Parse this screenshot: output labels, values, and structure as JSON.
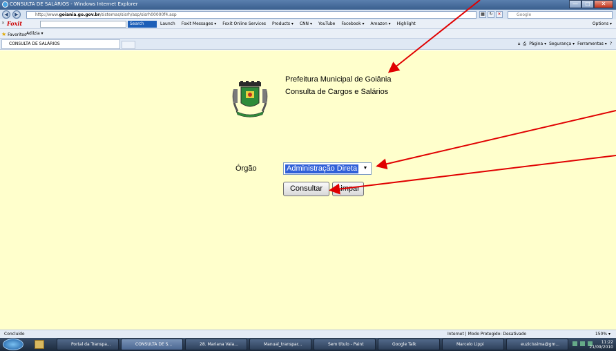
{
  "window": {
    "title": "CONSULTA DE SALÁRIOS - Windows Internet Explorer",
    "controls": [
      "—",
      "▢",
      "✕"
    ]
  },
  "address": {
    "url_prefix": "http://www.",
    "url_domain": "goiania.go.gov.br",
    "url_path": "/sistemas/sisrh/asp/sisrh00000f4.asp",
    "search_placeholder": "Google"
  },
  "foxit_toolbar": {
    "logo": "Foxit",
    "search_button": "Search",
    "links": [
      "Launch",
      "Foxit Messages ▾",
      "Foxit Online Services",
      "Products ▾",
      "CNN ▾",
      "YouTube",
      "Facebook ▾",
      "Amazon ▾",
      "Highlight"
    ],
    "options": "Options ▾"
  },
  "favorites_bar": {
    "favorites": "Favoritos",
    "adilzia": "Adilzia ▾"
  },
  "tab": {
    "label": "CONSULTA DE SALÁRIOS",
    "commands": [
      "Página ▾",
      "Segurança ▾",
      "Ferramentas ▾"
    ]
  },
  "page": {
    "header_line1": "Prefeitura Municipal de Goiânia",
    "header_line2": "Consulta de Cargos e Salários",
    "orgao_label": "Órgão",
    "orgao_selected": "Administração Direta",
    "consultar_button": "Consultar",
    "limpar_button": "Limpar",
    "background_color": "#ffffcc",
    "arrow_color": "#e00000"
  },
  "status": {
    "left": "Concluído",
    "zone": "Internet | Modo Protegido: Desativado",
    "zoom": "150% ▾"
  },
  "taskbar": {
    "tasks": [
      "Portal da Transpa...",
      "CONSULTA DE S...",
      "28. Mariana Vala...",
      "Manual_transpar...",
      "Sem título - Paint",
      "Google Talk",
      "Marcelo Lippi",
      "euzicissima@gm..."
    ],
    "time": "11:22",
    "date": "21/09/2010"
  }
}
